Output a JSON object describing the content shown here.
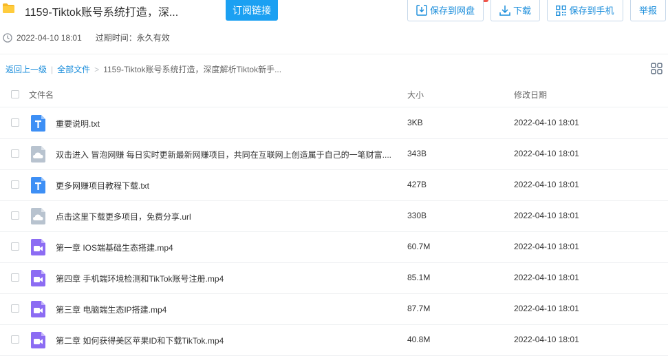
{
  "header": {
    "title": "1159-Tiktok账号系统打造，深...",
    "subscribe_label": "订阅链接",
    "buttons": [
      {
        "label": "保存到网盘",
        "icon": "save-to-cloud-icon"
      },
      {
        "label": "下载",
        "icon": "download-icon"
      },
      {
        "label": "保存到手机",
        "icon": "qr-code-icon"
      },
      {
        "label": "举报",
        "icon": ""
      }
    ],
    "accent_color": "#1ba0f2"
  },
  "meta": {
    "shared_time": "2022-04-10 18:01",
    "expire": "过期时间：永久有效"
  },
  "breadcrumb": {
    "back": "返回上一级",
    "all_files": "全部文件",
    "separator": ">",
    "current": "1159-Tiktok账号系统打造，深度解析Tiktok新手..."
  },
  "table": {
    "columns": {
      "name": "文件名",
      "size": "大小",
      "modified": "修改日期"
    },
    "rows": [
      {
        "type": "txt",
        "name": "重要说明.txt",
        "size": "3KB",
        "modified": "2022-04-10 18:01"
      },
      {
        "type": "url",
        "name": "双击进入 冒泡网赚 每日实时更新最新网赚项目，共同在互联网上创造属于自己的一笔财富....",
        "size": "343B",
        "modified": "2022-04-10 18:01"
      },
      {
        "type": "txt",
        "name": "更多网赚项目教程下载.txt",
        "size": "427B",
        "modified": "2022-04-10 18:01"
      },
      {
        "type": "url",
        "name": "点击这里下载更多项目，免费分享.url",
        "size": "330B",
        "modified": "2022-04-10 18:01"
      },
      {
        "type": "video",
        "name": "第一章 IOS端基础生态搭建.mp4",
        "size": "60.7M",
        "modified": "2022-04-10 18:01"
      },
      {
        "type": "video",
        "name": "第四章 手机端环境检测和TikTok账号注册.mp4",
        "size": "85.1M",
        "modified": "2022-04-10 18:01"
      },
      {
        "type": "video",
        "name": "第三章 电脑端生态IP搭建.mp4",
        "size": "87.7M",
        "modified": "2022-04-10 18:01"
      },
      {
        "type": "video",
        "name": "第二章 如何获得美区苹果ID和下载TikTok.mp4",
        "size": "40.8M",
        "modified": "2022-04-10 18:01"
      }
    ]
  }
}
